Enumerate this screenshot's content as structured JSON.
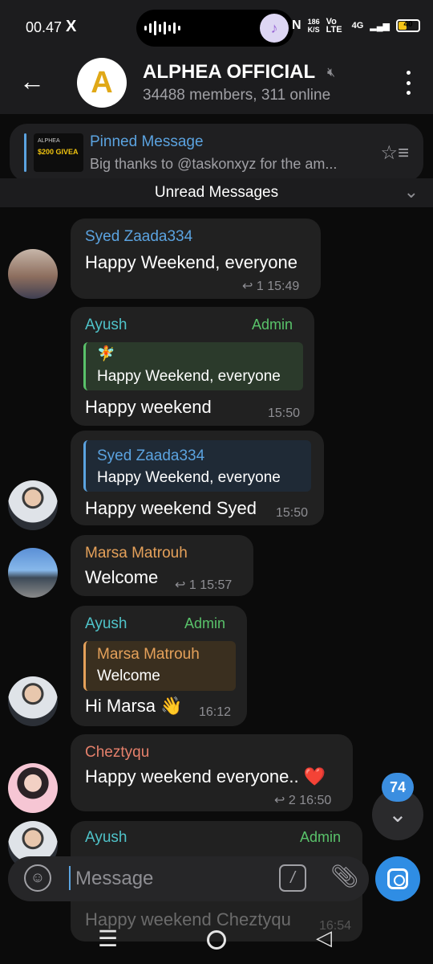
{
  "status_bar": {
    "time": "00.47",
    "x_icon": "X",
    "speed_value": "186",
    "speed_unit": "K/S",
    "volte": "Vo LTE",
    "network": "4G",
    "battery": "40",
    "battery_level": 0.4
  },
  "header": {
    "back_icon": "arrow-left-icon",
    "group_avatar_letter": "A",
    "title": "ALPHEA OFFICIAL",
    "members": "34488 members, 311 online",
    "mute_icon": "muted-icon",
    "more_icon": "vertical-dots-icon"
  },
  "pinned": {
    "thumb_logo": "ALPHEA",
    "thumb_text": "$200 GIVEA",
    "title": "Pinned Message",
    "text": "Big thanks to @taskonxyz for the am..."
  },
  "unread_label": "Unread Messages",
  "messages": [
    {
      "sender": "Syed Zaada334",
      "sender_color": "#5ba3e0",
      "text": "Happy Weekend, everyone",
      "replies": "1",
      "time": "15:49"
    },
    {
      "sender": "Ayush",
      "sender_color": "#4fc3c9",
      "badge": "Admin",
      "reply_icon": "🧚",
      "reply_text": "Happy Weekend, everyone",
      "text": "Happy weekend",
      "time": "15:50"
    },
    {
      "reply_name": "Syed Zaada334",
      "reply_text": "Happy Weekend, everyone",
      "text": "Happy weekend Syed",
      "time": "15:50"
    },
    {
      "sender": "Marsa Matrouh",
      "sender_color": "#e5a15a",
      "text": "Welcome",
      "replies": "1",
      "time": "15:57"
    },
    {
      "sender": "Ayush",
      "sender_color": "#4fc3c9",
      "badge": "Admin",
      "reply_name": "Marsa Matrouh",
      "reply_text": "Welcome",
      "text": "Hi Marsa 👋",
      "time": "16:12"
    },
    {
      "sender": "Cheztyqu",
      "sender_color": "#e5806b",
      "text": "Happy weekend everyone.. ❤️",
      "replies": "2",
      "time": "16:50"
    },
    {
      "sender": "Ayush",
      "sender_color": "#4fc3c9",
      "badge": "Admin",
      "text": "Happy weekend Cheztyqu",
      "time": "16:54"
    }
  ],
  "composer": {
    "placeholder": "Message",
    "command_symbol": "/"
  },
  "scroll": {
    "unread_count": "74"
  }
}
